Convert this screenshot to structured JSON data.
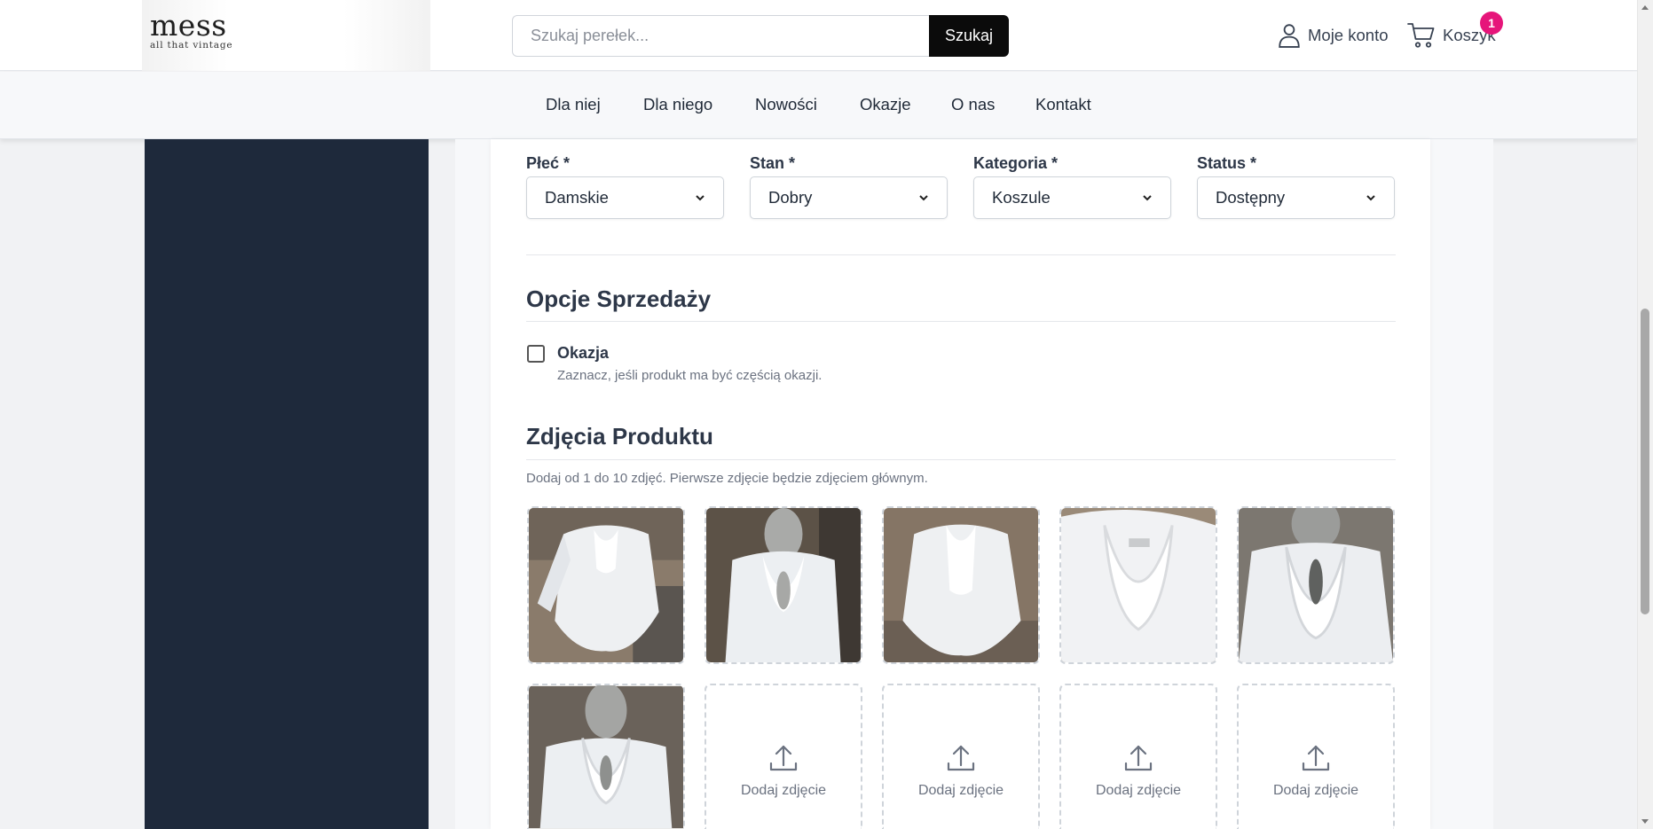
{
  "header": {
    "logo_main": "mess",
    "logo_sub": "all that vintage",
    "search_placeholder": "Szukaj perełek...",
    "search_button": "Szukaj",
    "account_label": "Moje konto",
    "cart_label": "Koszyk",
    "cart_count": "1"
  },
  "nav": {
    "items": [
      "Dla niej",
      "Dla niego",
      "Nowości",
      "Okazje",
      "O nas",
      "Kontakt"
    ]
  },
  "form": {
    "fields": [
      {
        "label": "Płeć *",
        "value": "Damskie"
      },
      {
        "label": "Stan *",
        "value": "Dobry"
      },
      {
        "label": "Kategoria *",
        "value": "Koszule"
      },
      {
        "label": "Status *",
        "value": "Dostępny"
      }
    ],
    "sales_title": "Opcje Sprzedaży",
    "okazja_label": "Okazja",
    "okazja_help": "Zaznacz, jeśli produkt ma być częścią okazji.",
    "okazja_checked": false,
    "photos_title": "Zdjęcia Produktu",
    "photos_help": "Dodaj od 1 do 10 zdjęć. Pierwsze zdjęcie będzie zdjęciem głównym.",
    "upload_label": "Dodaj zdjęcie"
  },
  "colors": {
    "accent_badge": "#e6157a",
    "sidebar": "#1e293b",
    "button": "#0b0b0b"
  }
}
